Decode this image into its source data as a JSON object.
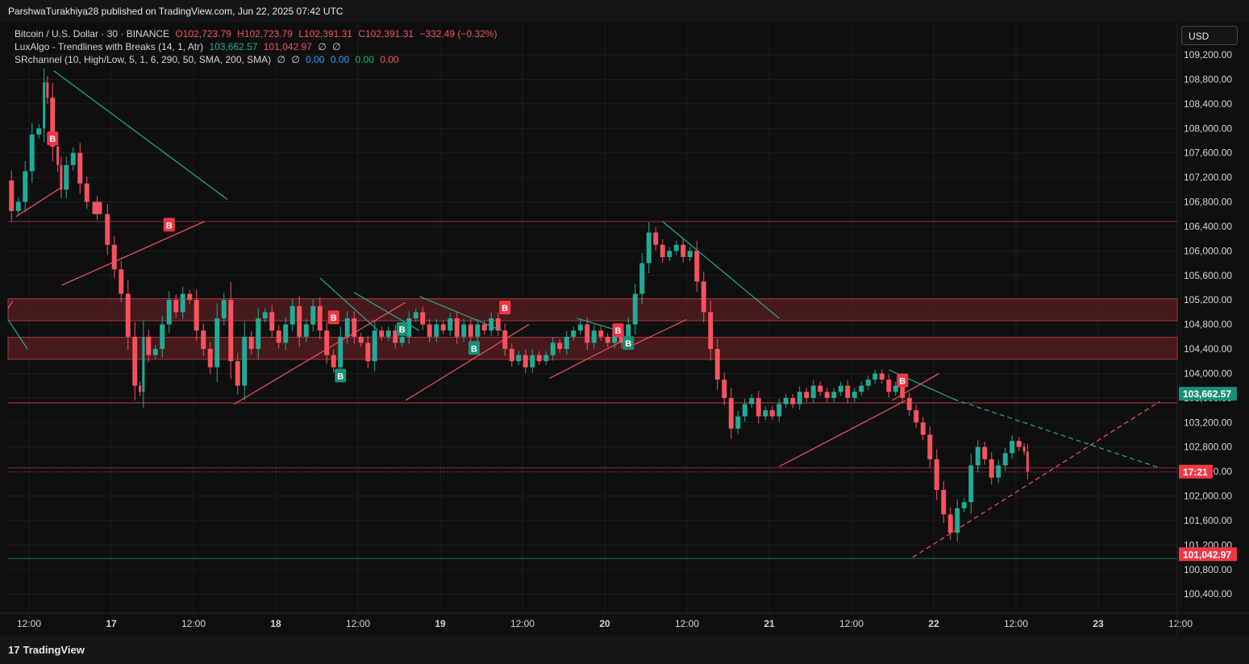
{
  "header": {
    "published": "ParshwaTurakhiya28 published on TradingView.com, Jun 22, 2025 07:42 UTC"
  },
  "legend": {
    "symbol": "Bitcoin / U.S. Dollar · 30 · BINANCE",
    "open": "O102,723.79",
    "high": "H102,723.79",
    "low": "L102,391.31",
    "close": "C102,391.31",
    "change": "−332.49 (−0.32%)",
    "ind1_name": "LuxAlgo - Trendlines with Breaks (14, 1, Atr)",
    "ind1_v1": "103,662.57",
    "ind1_v2": "101,042.97",
    "ind1_v3": "∅",
    "ind1_v4": "∅",
    "ind2_name": "SRchannel (10, High/Low, 5, 1, 6, 290, 50, SMA, 200, SMA)",
    "ind2_v1": "∅",
    "ind2_v2": "∅",
    "ind2_v3": "0.00",
    "ind2_v4": "0.00",
    "ind2_v5": "0.00",
    "ind2_v6": "0.00"
  },
  "toolbar": {
    "currency": "USD"
  },
  "footer": {
    "brand": "TradingView",
    "brand_mark": "17"
  },
  "colors": {
    "up": "#22ab94",
    "down": "#f7525f",
    "zone": "#5a1f22",
    "zone_border": "#a8383d",
    "grid": "#1e1e1e",
    "support": "#1f6b4a"
  },
  "chart_data": {
    "type": "candlestick",
    "symbol": "BTCUSD",
    "interval": "30",
    "y_axis": {
      "ticks": [
        100400,
        100800,
        101200,
        101600,
        102000,
        102400,
        102800,
        103200,
        103600,
        104000,
        104400,
        104800,
        105200,
        105600,
        106000,
        106400,
        106800,
        107200,
        107600,
        108000,
        108400,
        108800,
        109200
      ],
      "labels": [
        "100,400.00",
        "100,800.00",
        "101,200.00",
        "101,600.00",
        "102,000.00",
        "102,400.00",
        "102,800.00",
        "103,200.00",
        "103,600.00",
        "104,000.00",
        "104,400.00",
        "104,800.00",
        "105,200.00",
        "105,600.00",
        "106,000.00",
        "106,400.00",
        "106,800.00",
        "107,200.00",
        "107,600.00",
        "108,000.00",
        "108,400.00",
        "108,800.00",
        "109,200.00"
      ],
      "range": [
        100100,
        109700
      ]
    },
    "x_axis": {
      "labels": [
        "12:00",
        "17",
        "12:00",
        "18",
        "12:00",
        "19",
        "12:00",
        "20",
        "12:00",
        "21",
        "12:00",
        "22",
        "12:00",
        "23",
        "12:00"
      ],
      "bold": [
        false,
        true,
        false,
        true,
        false,
        true,
        false,
        true,
        false,
        true,
        false,
        true,
        false,
        true,
        false
      ],
      "start": "2025-06-16T12:00",
      "end": "2025-06-23T12:00"
    },
    "price_tags": [
      {
        "label": "103,662.57",
        "value": 103662.57,
        "color": "#1a8f76"
      },
      {
        "label": "17:21",
        "value": 102391.31,
        "color": "#f23645"
      },
      {
        "label": "101,042.97",
        "value": 101042.97,
        "color": "#f23645"
      }
    ],
    "zones": [
      {
        "low": 104860,
        "high": 105220
      },
      {
        "low": 104230,
        "high": 104590
      }
    ],
    "levels": [
      {
        "value": 106480,
        "color": "#7a2a2e"
      },
      {
        "value": 103520,
        "color": "#a8383d"
      },
      {
        "value": 102460,
        "color": "#7a2a2e"
      },
      {
        "value": 100980,
        "color": "#1f6b4a"
      }
    ],
    "trendlines": [
      {
        "from": [
          "2025-06-16T18:40",
          108940
        ],
        "to": [
          "2025-06-17T20:00",
          106840
        ],
        "color": "#22ab94",
        "dashed": false
      },
      {
        "from": [
          "2025-06-16T12:00",
          104880
        ],
        "to": [
          "2025-06-16T14:50",
          104400
        ],
        "color": "#22ab94",
        "dashed": false
      },
      {
        "from": [
          "2025-06-18T09:30",
          105560
        ],
        "to": [
          "2025-06-18T18:00",
          104700
        ],
        "color": "#22ab94",
        "dashed": false
      },
      {
        "from": [
          "2025-06-18T14:30",
          105320
        ],
        "to": [
          "2025-06-19T00:00",
          104700
        ],
        "color": "#22ab94",
        "dashed": false
      },
      {
        "from": [
          "2025-06-19T00:00",
          105260
        ],
        "to": [
          "2025-06-19T12:00",
          104700
        ],
        "color": "#22ab94",
        "dashed": false
      },
      {
        "from": [
          "2025-06-19T23:00",
          104900
        ],
        "to": [
          "2025-06-20T05:00",
          104700
        ],
        "color": "#22ab94",
        "dashed": false
      },
      {
        "from": [
          "2025-06-20T11:30",
          106480
        ],
        "to": [
          "2025-06-21T04:30",
          104900
        ],
        "color": "#22ab94",
        "dashed": false
      },
      {
        "from": [
          "2025-06-21T20:30",
          104060
        ],
        "to": [
          "2025-06-22T06:00",
          103580
        ],
        "color": "#22ab94",
        "dashed": false
      },
      {
        "from": [
          "2025-06-22T06:00",
          103580
        ],
        "to": [
          "2025-06-23T12:00",
          102460
        ],
        "color": "#22ab94",
        "dashed": true
      },
      {
        "from": [
          "2025-06-16T12:40",
          105180
        ],
        "to": [
          "2025-06-16T12:00",
          105060
        ],
        "color": "#f7525f",
        "dashed": false
      },
      {
        "from": [
          "2025-06-16T13:10",
          106560
        ],
        "to": [
          "2025-06-16T19:50",
          107040
        ],
        "color": "#f7525f",
        "dashed": false
      },
      {
        "from": [
          "2025-06-16T19:50",
          105440
        ],
        "to": [
          "2025-06-17T16:40",
          106480
        ],
        "color": "#f7525f",
        "dashed": false
      },
      {
        "from": [
          "2025-06-17T21:00",
          103500
        ],
        "to": [
          "2025-06-18T22:00",
          105160
        ],
        "color": "#f7525f",
        "dashed": false
      },
      {
        "from": [
          "2025-06-18T22:00",
          103560
        ],
        "to": [
          "2025-06-19T16:00",
          104800
        ],
        "color": "#f7525f",
        "dashed": false
      },
      {
        "from": [
          "2025-06-19T19:00",
          103920
        ],
        "to": [
          "2025-06-20T06:00",
          104550
        ],
        "color": "#f7525f",
        "dashed": false
      },
      {
        "from": [
          "2025-06-20T06:00",
          104400
        ],
        "to": [
          "2025-06-20T15:00",
          104880
        ],
        "color": "#f7525f",
        "dashed": false
      },
      {
        "from": [
          "2025-06-21T04:30",
          102480
        ],
        "to": [
          "2025-06-21T23:00",
          103560
        ],
        "color": "#f7525f",
        "dashed": false
      },
      {
        "from": [
          "2025-06-21T21:00",
          103560
        ],
        "to": [
          "2025-06-22T03:50",
          104000
        ],
        "color": "#f7525f",
        "dashed": false
      },
      {
        "from": [
          "2025-06-22T00:00",
          101000
        ],
        "to": [
          "2025-06-23T12:00",
          103540
        ],
        "color": "#f7525f",
        "dashed": true
      }
    ],
    "break_markers": [
      {
        "time": "2025-06-16T18:30",
        "value": 107830,
        "kind": "down",
        "label": "B"
      },
      {
        "time": "2025-06-17T11:30",
        "value": 106420,
        "kind": "down",
        "label": "B"
      },
      {
        "time": "2025-06-18T11:30",
        "value": 104910,
        "kind": "down",
        "label": "B"
      },
      {
        "time": "2025-06-18T12:30",
        "value": 103960,
        "kind": "up",
        "label": "B"
      },
      {
        "time": "2025-06-18T21:30",
        "value": 104720,
        "kind": "up",
        "label": "B"
      },
      {
        "time": "2025-06-19T08:00",
        "value": 104410,
        "kind": "up",
        "label": "B"
      },
      {
        "time": "2025-06-19T12:30",
        "value": 105070,
        "kind": "down",
        "label": "B"
      },
      {
        "time": "2025-06-20T05:00",
        "value": 104700,
        "kind": "down",
        "label": "B"
      },
      {
        "time": "2025-06-20T06:30",
        "value": 104490,
        "kind": "up",
        "label": "B"
      },
      {
        "time": "2025-06-21T22:30",
        "value": 103880,
        "kind": "down",
        "label": "B"
      }
    ],
    "price_path": [
      [
        "2025-06-16T12:00",
        107150
      ],
      [
        "2025-06-16T13:00",
        106650
      ],
      [
        "2025-06-16T14:00",
        106800
      ],
      [
        "2025-06-16T15:00",
        107300
      ],
      [
        "2025-06-16T16:00",
        107900
      ],
      [
        "2025-06-16T17:00",
        108000
      ],
      [
        "2025-06-16T17:30",
        108750
      ],
      [
        "2025-06-16T18:00",
        108500
      ],
      [
        "2025-06-16T19:00",
        107700
      ],
      [
        "2025-06-16T19:30",
        107400
      ],
      [
        "2025-06-16T20:00",
        107000
      ],
      [
        "2025-06-16T21:00",
        107400
      ],
      [
        "2025-06-16T22:00",
        107600
      ],
      [
        "2025-06-16T23:00",
        107100
      ],
      [
        "2025-06-17T00:00",
        106800
      ],
      [
        "2025-06-17T02:00",
        106600
      ],
      [
        "2025-06-17T03:00",
        106100
      ],
      [
        "2025-06-17T04:00",
        105700
      ],
      [
        "2025-06-17T05:00",
        105300
      ],
      [
        "2025-06-17T06:00",
        104600
      ],
      [
        "2025-06-17T07:00",
        103800
      ],
      [
        "2025-06-17T07:30",
        103700
      ],
      [
        "2025-06-17T08:00",
        104600
      ],
      [
        "2025-06-17T09:00",
        104300
      ],
      [
        "2025-06-17T10:00",
        104400
      ],
      [
        "2025-06-17T11:00",
        104800
      ],
      [
        "2025-06-17T12:00",
        105200
      ],
      [
        "2025-06-17T13:00",
        105000
      ],
      [
        "2025-06-17T14:00",
        105300
      ],
      [
        "2025-06-17T15:00",
        105200
      ],
      [
        "2025-06-17T16:00",
        104700
      ],
      [
        "2025-06-17T17:00",
        104400
      ],
      [
        "2025-06-17T18:00",
        104100
      ],
      [
        "2025-06-17T19:00",
        104900
      ],
      [
        "2025-06-17T20:00",
        105200
      ],
      [
        "2025-06-17T21:00",
        104200
      ],
      [
        "2025-06-17T22:00",
        103800
      ],
      [
        "2025-06-17T23:00",
        104600
      ],
      [
        "2025-06-18T00:00",
        104400
      ],
      [
        "2025-06-18T01:00",
        104900
      ],
      [
        "2025-06-18T02:00",
        105000
      ],
      [
        "2025-06-18T03:00",
        104700
      ],
      [
        "2025-06-18T04:00",
        104500
      ],
      [
        "2025-06-18T05:00",
        104800
      ],
      [
        "2025-06-18T06:00",
        105100
      ],
      [
        "2025-06-18T07:00",
        104600
      ],
      [
        "2025-06-18T08:00",
        104800
      ],
      [
        "2025-06-18T09:00",
        105100
      ],
      [
        "2025-06-18T10:00",
        104700
      ],
      [
        "2025-06-18T11:00",
        104300
      ],
      [
        "2025-06-18T12:00",
        104100
      ],
      [
        "2025-06-18T13:00",
        104600
      ],
      [
        "2025-06-18T14:00",
        104900
      ],
      [
        "2025-06-18T15:00",
        104600
      ],
      [
        "2025-06-18T16:00",
        104500
      ],
      [
        "2025-06-18T17:00",
        104200
      ],
      [
        "2025-06-18T18:00",
        104700
      ],
      [
        "2025-06-18T19:00",
        104600
      ],
      [
        "2025-06-18T20:00",
        104700
      ],
      [
        "2025-06-18T21:00",
        104500
      ],
      [
        "2025-06-18T22:00",
        104600
      ],
      [
        "2025-06-18T23:00",
        104900
      ],
      [
        "2025-06-19T00:00",
        105000
      ],
      [
        "2025-06-19T01:00",
        104800
      ],
      [
        "2025-06-19T02:00",
        104600
      ],
      [
        "2025-06-19T03:00",
        104800
      ],
      [
        "2025-06-19T04:00",
        104700
      ],
      [
        "2025-06-19T05:00",
        104900
      ],
      [
        "2025-06-19T06:00",
        104600
      ],
      [
        "2025-06-19T07:00",
        104800
      ],
      [
        "2025-06-19T08:00",
        104600
      ],
      [
        "2025-06-19T09:00",
        104800
      ],
      [
        "2025-06-19T10:00",
        104700
      ],
      [
        "2025-06-19T11:00",
        104900
      ],
      [
        "2025-06-19T12:00",
        104700
      ],
      [
        "2025-06-19T13:00",
        104400
      ],
      [
        "2025-06-19T14:00",
        104200
      ],
      [
        "2025-06-19T15:00",
        104300
      ],
      [
        "2025-06-19T16:00",
        104100
      ],
      [
        "2025-06-19T17:00",
        104300
      ],
      [
        "2025-06-19T18:00",
        104200
      ],
      [
        "2025-06-19T19:00",
        104300
      ],
      [
        "2025-06-19T20:00",
        104500
      ],
      [
        "2025-06-19T21:00",
        104400
      ],
      [
        "2025-06-19T22:00",
        104600
      ],
      [
        "2025-06-19T23:00",
        104700
      ],
      [
        "2025-06-20T00:00",
        104800
      ],
      [
        "2025-06-20T01:00",
        104500
      ],
      [
        "2025-06-20T02:00",
        104700
      ],
      [
        "2025-06-20T03:00",
        104600
      ],
      [
        "2025-06-20T04:00",
        104500
      ],
      [
        "2025-06-20T05:00",
        104700
      ],
      [
        "2025-06-20T06:00",
        104500
      ],
      [
        "2025-06-20T07:00",
        104800
      ],
      [
        "2025-06-20T08:00",
        105300
      ],
      [
        "2025-06-20T09:00",
        105800
      ],
      [
        "2025-06-20T10:00",
        106300
      ],
      [
        "2025-06-20T11:00",
        106100
      ],
      [
        "2025-06-20T12:00",
        105900
      ],
      [
        "2025-06-20T13:00",
        106000
      ],
      [
        "2025-06-20T14:00",
        106100
      ],
      [
        "2025-06-20T15:00",
        105900
      ],
      [
        "2025-06-20T16:00",
        106000
      ],
      [
        "2025-06-20T17:00",
        105500
      ],
      [
        "2025-06-20T18:00",
        105000
      ],
      [
        "2025-06-20T19:00",
        104400
      ],
      [
        "2025-06-20T20:00",
        103900
      ],
      [
        "2025-06-20T21:00",
        103600
      ],
      [
        "2025-06-20T22:00",
        103100
      ],
      [
        "2025-06-20T23:00",
        103300
      ],
      [
        "2025-06-21T00:00",
        103500
      ],
      [
        "2025-06-21T01:00",
        103600
      ],
      [
        "2025-06-21T02:00",
        103300
      ],
      [
        "2025-06-21T03:00",
        103400
      ],
      [
        "2025-06-21T04:00",
        103300
      ],
      [
        "2025-06-21T05:00",
        103500
      ],
      [
        "2025-06-21T06:00",
        103600
      ],
      [
        "2025-06-21T07:00",
        103500
      ],
      [
        "2025-06-21T08:00",
        103700
      ],
      [
        "2025-06-21T09:00",
        103600
      ],
      [
        "2025-06-21T10:00",
        103800
      ],
      [
        "2025-06-21T11:00",
        103700
      ],
      [
        "2025-06-21T12:00",
        103600
      ],
      [
        "2025-06-21T13:00",
        103700
      ],
      [
        "2025-06-21T14:00",
        103800
      ],
      [
        "2025-06-21T15:00",
        103600
      ],
      [
        "2025-06-21T16:00",
        103700
      ],
      [
        "2025-06-21T17:00",
        103800
      ],
      [
        "2025-06-21T18:00",
        103900
      ],
      [
        "2025-06-21T19:00",
        104000
      ],
      [
        "2025-06-21T20:00",
        103900
      ],
      [
        "2025-06-21T21:00",
        103700
      ],
      [
        "2025-06-21T22:00",
        103800
      ],
      [
        "2025-06-21T23:00",
        103600
      ],
      [
        "2025-06-22T00:00",
        103400
      ],
      [
        "2025-06-22T01:00",
        103200
      ],
      [
        "2025-06-22T02:00",
        103000
      ],
      [
        "2025-06-22T03:00",
        102600
      ],
      [
        "2025-06-22T04:00",
        102100
      ],
      [
        "2025-06-22T05:00",
        101700
      ],
      [
        "2025-06-22T06:00",
        101400
      ],
      [
        "2025-06-22T07:00",
        101800
      ],
      [
        "2025-06-22T08:00",
        101900
      ],
      [
        "2025-06-22T09:00",
        102500
      ],
      [
        "2025-06-22T10:00",
        102800
      ],
      [
        "2025-06-22T11:00",
        102600
      ],
      [
        "2025-06-22T12:00",
        102300
      ],
      [
        "2025-06-22T13:00",
        102500
      ],
      [
        "2025-06-22T14:00",
        102700
      ],
      [
        "2025-06-22T15:00",
        102900
      ],
      [
        "2025-06-22T16:00",
        102800
      ],
      [
        "2025-06-22T16:30",
        102723.79
      ],
      [
        "2025-06-22T17:00",
        102391.31
      ]
    ]
  }
}
